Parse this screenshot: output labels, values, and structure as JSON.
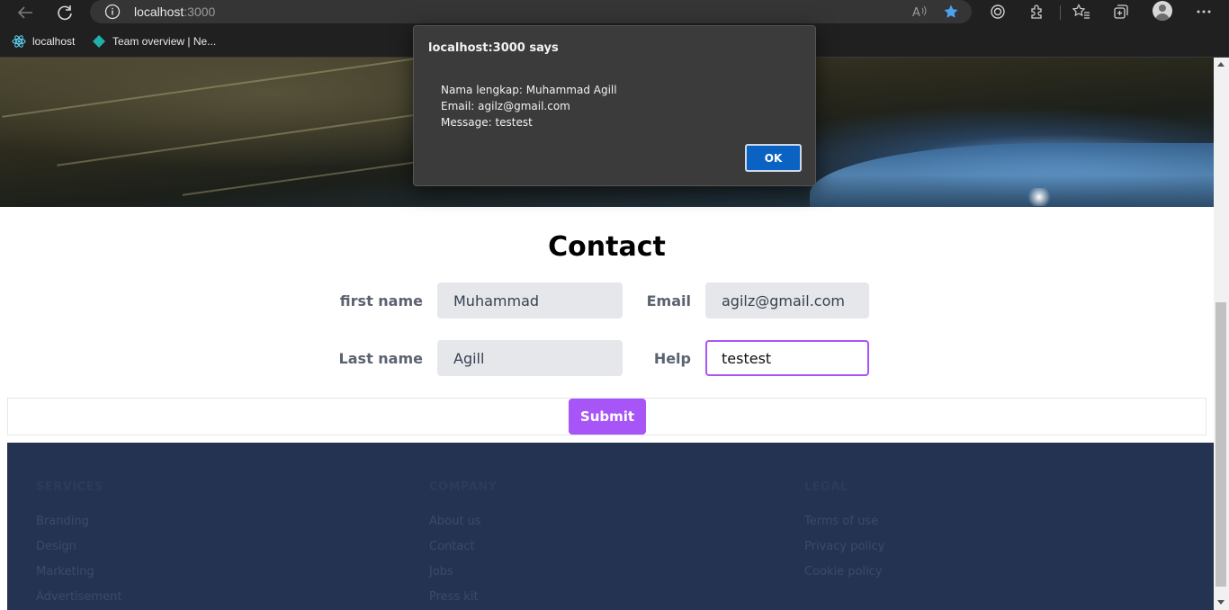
{
  "browser": {
    "url_host": "localhost",
    "url_port": ":3000",
    "bookmarks": [
      "localhost",
      "Team overview | Ne..."
    ]
  },
  "dialog": {
    "title": "localhost:3000 says",
    "lines": [
      "Nama lengkap: Muhammad  Agill",
      "Email: agilz@gmail.com",
      "Message: testest"
    ],
    "ok_label": "OK"
  },
  "contact": {
    "title": "Contact",
    "first_name_label": "first name",
    "first_name_value": "Muhammad",
    "last_name_label": "Last name",
    "last_name_value": "Agill",
    "email_label": "Email",
    "email_value": "agilz@gmail.com",
    "help_label": "Help",
    "help_value": "testest",
    "submit_label": "Submit"
  },
  "footer": {
    "services": {
      "heading": "SERVICES",
      "links": [
        "Branding",
        "Design",
        "Marketing",
        "Advertisement"
      ]
    },
    "company": {
      "heading": "COMPANY",
      "links": [
        "About us",
        "Contact",
        "Jobs",
        "Press kit"
      ]
    },
    "legal": {
      "heading": "LEGAL",
      "links": [
        "Terms of use",
        "Privacy policy",
        "Cookie policy"
      ]
    }
  },
  "colors": {
    "accent": "#a855f7",
    "footer_bg": "#253352",
    "dialog_bg": "#3b3b3b",
    "ok_button": "#0a62c2"
  },
  "icons": [
    "back-arrow-icon",
    "refresh-icon",
    "info-icon",
    "read-aloud-icon",
    "favorite-star-icon",
    "tracking-icon",
    "extensions-icon",
    "favorites-icon",
    "collections-icon",
    "profile-avatar-icon",
    "more-icon",
    "react-icon",
    "diamond-icon"
  ]
}
